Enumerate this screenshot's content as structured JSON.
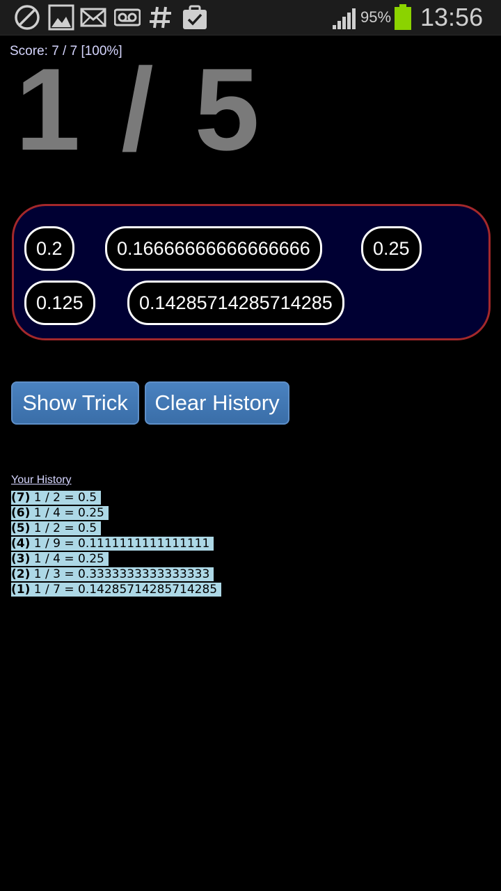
{
  "status_bar": {
    "left_icons": [
      "blocked-icon",
      "image-icon",
      "mail-icon",
      "voicemail-icon",
      "hash-icon",
      "clipboard-check-icon"
    ],
    "battery_percent": "95%",
    "time": "13:56",
    "battery_color": "#8bd300"
  },
  "score": "Score: 7 / 7 [100%]",
  "question": "1 / 5",
  "answers": [
    "0.2",
    "0.16666666666666666",
    "0.25",
    "0.125",
    "0.14285714285714285"
  ],
  "buttons": {
    "show_trick": "Show Trick",
    "clear_history": "Clear History"
  },
  "history": {
    "title": "Your History",
    "items": [
      {
        "index": "(7)",
        "text": "1 / 2 = 0.5"
      },
      {
        "index": "(6)",
        "text": "1 / 4 = 0.25"
      },
      {
        "index": "(5)",
        "text": "1 / 2 = 0.5"
      },
      {
        "index": "(4)",
        "text": "1 / 9 = 0.1111111111111111"
      },
      {
        "index": "(3)",
        "text": "1 / 4 = 0.25"
      },
      {
        "index": "(2)",
        "text": "1 / 3 = 0.3333333333333333"
      },
      {
        "index": "(1)",
        "text": "1 / 7 = 0.14285714285714285"
      }
    ]
  },
  "colors": {
    "panel_bg": "#000033",
    "panel_border": "#a3282b",
    "history_highlight": "#add8e6",
    "button": "#3a6ea8"
  }
}
